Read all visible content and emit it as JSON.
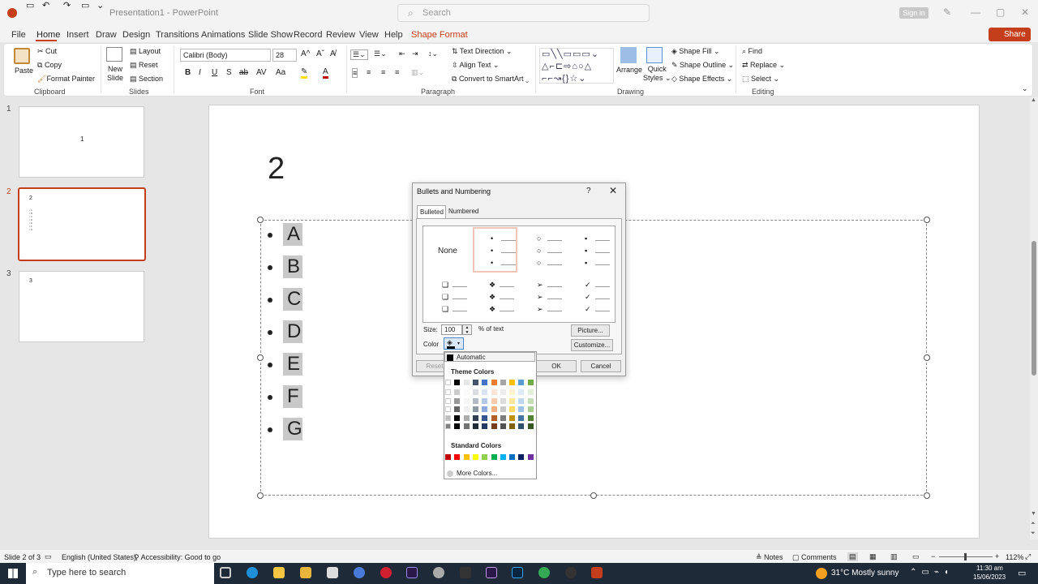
{
  "titlebar": {
    "title": "Presentation1  -  PowerPoint",
    "search_placeholder": "Search",
    "signin": "Sign in"
  },
  "menu": {
    "tabs": [
      "File",
      "Home",
      "Insert",
      "Draw",
      "Design",
      "Transitions",
      "Animations",
      "Slide Show",
      "Record",
      "Review",
      "View",
      "Help",
      "Shape Format"
    ],
    "share": "Share"
  },
  "ribbon": {
    "clipboard": {
      "paste": "Paste",
      "cut": "Cut",
      "copy": "Copy",
      "format_painter": "Format Painter",
      "label": "Clipboard"
    },
    "slides": {
      "new_slide_1": "New",
      "new_slide_2": "Slide",
      "layout": "Layout",
      "reset": "Reset",
      "section": "Section",
      "label": "Slides"
    },
    "font": {
      "font_name": "Calibri (Body)",
      "font_size": "28",
      "label": "Font"
    },
    "paragraph": {
      "text_direction": "Text Direction",
      "align_text": "Align Text",
      "convert_smartart": "Convert to SmartArt",
      "label": "Paragraph"
    },
    "drawing": {
      "arrange": "Arrange",
      "quick_styles_1": "Quick",
      "quick_styles_2": "Styles",
      "shape_fill": "Shape Fill",
      "shape_outline": "Shape Outline",
      "shape_effects": "Shape Effects",
      "label": "Drawing"
    },
    "editing": {
      "find": "Find",
      "replace": "Replace",
      "select": "Select",
      "label": "Editing"
    }
  },
  "slides_pane": [
    {
      "num": "1",
      "text": "1"
    },
    {
      "num": "2",
      "text": "2"
    },
    {
      "num": "3",
      "text": "3"
    }
  ],
  "slide": {
    "title": "2",
    "bullets": [
      "A",
      "B",
      "C",
      "D",
      "E",
      "F",
      "G"
    ]
  },
  "dialog": {
    "title": "Bullets and Numbering",
    "help": "?",
    "tabs": [
      "Bulleted",
      "Numbered"
    ],
    "none_label": "None",
    "size_label": "Size:",
    "size_value": "100",
    "size_unit": "% of text",
    "color_label": "Color",
    "picture": "Picture...",
    "customize": "Customize...",
    "reset": "Reset",
    "ok": "OK",
    "cancel": "Cancel"
  },
  "color_popup": {
    "automatic": "Automatic",
    "theme_colors": "Theme Colors",
    "standard_colors": "Standard Colors",
    "more_colors": "More Colors...",
    "theme_row": [
      "#ffffff",
      "#000000",
      "#e7e6e6",
      "#44546a",
      "#4472c4",
      "#ed7d31",
      "#a5a5a5",
      "#ffc000",
      "#5b9bd5",
      "#70ad47"
    ],
    "standard_row": [
      "#c00000",
      "#ff0000",
      "#ffc000",
      "#ffff00",
      "#92d050",
      "#00b050",
      "#00b0f0",
      "#0070c0",
      "#002060",
      "#7030a0"
    ]
  },
  "statusbar": {
    "slide_info": "Slide 2 of 3",
    "language": "English (United States)",
    "accessibility": "Accessibility: Good to go",
    "notes": "Notes",
    "comments": "Comments",
    "zoom": "112%"
  },
  "taskbar": {
    "search": "Type here to search",
    "weather": "31°C  Mostly sunny",
    "time": "11:30 am",
    "date": "15/06/2023"
  }
}
